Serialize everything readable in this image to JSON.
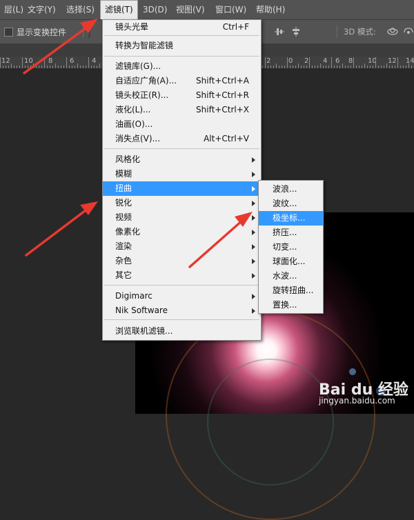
{
  "menubar": {
    "items": [
      "层(L)",
      "文字(Y)",
      "选择(S)",
      "滤镜(T)",
      "3D(D)",
      "视图(V)",
      "窗口(W)",
      "帮助(H)"
    ],
    "active": "滤镜(T)"
  },
  "options_bar": {
    "show_transform_label": "显示变换控件",
    "show_transform_checked": false,
    "mode_3d_label": "3D 模式:"
  },
  "ruler": {
    "labels": [
      "12",
      "10",
      "8",
      "6",
      "4",
      "2",
      "0",
      "2",
      "4",
      "6",
      "8",
      "10",
      "12",
      "14"
    ]
  },
  "filter_menu": {
    "rows": [
      {
        "label": "镜头光晕",
        "shortcut": "Ctrl+F"
      },
      {
        "label": "转换为智能滤镜"
      },
      {
        "label": "滤镜库(G)..."
      },
      {
        "label": "自适应广角(A)...",
        "shortcut": "Shift+Ctrl+A"
      },
      {
        "label": "镜头校正(R)...",
        "shortcut": "Shift+Ctrl+R"
      },
      {
        "label": "液化(L)...",
        "shortcut": "Shift+Ctrl+X"
      },
      {
        "label": "油画(O)..."
      },
      {
        "label": "消失点(V)...",
        "shortcut": "Alt+Ctrl+V"
      },
      {
        "label": "风格化",
        "submenu": true
      },
      {
        "label": "模糊",
        "submenu": true
      },
      {
        "label": "扭曲",
        "submenu": true,
        "highlighted": true
      },
      {
        "label": "锐化",
        "submenu": true
      },
      {
        "label": "视频",
        "submenu": true
      },
      {
        "label": "像素化",
        "submenu": true
      },
      {
        "label": "渲染",
        "submenu": true
      },
      {
        "label": "杂色",
        "submenu": true
      },
      {
        "label": "其它",
        "submenu": true
      },
      {
        "label": "Digimarc",
        "submenu": true
      },
      {
        "label": "Nik Software",
        "submenu": true
      },
      {
        "label": "浏览联机滤镜..."
      }
    ]
  },
  "distort_submenu": {
    "rows": [
      {
        "label": "波浪..."
      },
      {
        "label": "波纹..."
      },
      {
        "label": "极坐标...",
        "highlighted": true
      },
      {
        "label": "挤压..."
      },
      {
        "label": "切变..."
      },
      {
        "label": "球面化..."
      },
      {
        "label": "水波..."
      },
      {
        "label": "旋转扭曲..."
      },
      {
        "label": "置换..."
      }
    ]
  },
  "watermark": {
    "logo": "Bai du 经验",
    "url": "jingyan.baidu.com"
  },
  "colors": {
    "menu_highlight": "#3399ff",
    "arrow": "#e8392f",
    "ui_bar": "#535353"
  }
}
